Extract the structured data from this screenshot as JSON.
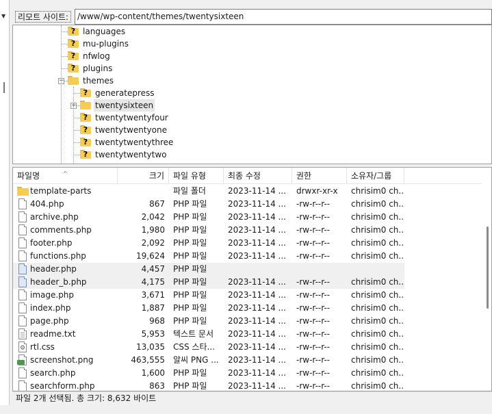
{
  "remote": {
    "label": "리모트 사이트:",
    "path": "/www/wp-content/themes/twentysixteen"
  },
  "tree": {
    "items": [
      {
        "name": "languages",
        "icon": "unknown-folder-icon",
        "level": 1
      },
      {
        "name": "mu-plugins",
        "icon": "unknown-folder-icon",
        "level": 1
      },
      {
        "name": "nfwlog",
        "icon": "unknown-folder-icon",
        "level": 1
      },
      {
        "name": "plugins",
        "icon": "unknown-folder-icon",
        "level": 1
      },
      {
        "name": "themes",
        "icon": "folder-icon",
        "level": 1,
        "expanded": true
      },
      {
        "name": "generatepress",
        "icon": "unknown-folder-icon",
        "level": 2
      },
      {
        "name": "twentysixteen",
        "icon": "folder-icon",
        "level": 2,
        "selected": true,
        "expander": "+"
      },
      {
        "name": "twentytwentyfour",
        "icon": "unknown-folder-icon",
        "level": 2
      },
      {
        "name": "twentytwentyone",
        "icon": "unknown-folder-icon",
        "level": 2
      },
      {
        "name": "twentytwentythree",
        "icon": "unknown-folder-icon",
        "level": 2
      },
      {
        "name": "twentytwentytwo",
        "icon": "unknown-folder-icon",
        "level": 2
      }
    ]
  },
  "list": {
    "columns": {
      "name": "파일명",
      "size": "크기",
      "type": "파일 유형",
      "modified": "최종 수정",
      "perms": "권한",
      "owner": "소유자/그룹"
    },
    "rows": [
      {
        "name": "template-parts",
        "icon": "folder-icon",
        "size": "",
        "type": "파일 폴더",
        "modified": "2023-11-14 ...",
        "perms": "drwxr-xr-x",
        "owner": "chrisim0 ch...",
        "selected": false
      },
      {
        "name": "404.php",
        "icon": "file-icon",
        "size": "867",
        "type": "PHP 파일",
        "modified": "2023-11-14 ...",
        "perms": "-rw-r--r--",
        "owner": "chrisim0 ch...",
        "selected": false
      },
      {
        "name": "archive.php",
        "icon": "file-icon",
        "size": "2,042",
        "type": "PHP 파일",
        "modified": "2023-11-14 ...",
        "perms": "-rw-r--r--",
        "owner": "chrisim0 ch...",
        "selected": false
      },
      {
        "name": "comments.php",
        "icon": "file-icon",
        "size": "1,980",
        "type": "PHP 파일",
        "modified": "2023-11-14 ...",
        "perms": "-rw-r--r--",
        "owner": "chrisim0 ch...",
        "selected": false
      },
      {
        "name": "footer.php",
        "icon": "file-icon",
        "size": "2,092",
        "type": "PHP 파일",
        "modified": "2023-11-14 ...",
        "perms": "-rw-r--r--",
        "owner": "chrisim0 ch...",
        "selected": false
      },
      {
        "name": "functions.php",
        "icon": "file-icon",
        "size": "19,624",
        "type": "PHP 파일",
        "modified": "2023-11-14 ...",
        "perms": "-rw-r--r--",
        "owner": "chrisim0 ch...",
        "selected": false
      },
      {
        "name": "header.php",
        "icon": "file-icon",
        "size": "4,457",
        "type": "PHP 파일",
        "modified": "",
        "perms": "",
        "owner": "",
        "selected": true
      },
      {
        "name": "header_b.php",
        "icon": "file-icon",
        "size": "4,175",
        "type": "PHP 파일",
        "modified": "2023-11-14 ...",
        "perms": "-rw-r--r--",
        "owner": "chrisim0 ch...",
        "selected": true
      },
      {
        "name": "image.php",
        "icon": "file-icon",
        "size": "3,671",
        "type": "PHP 파일",
        "modified": "2023-11-14 ...",
        "perms": "-rw-r--r--",
        "owner": "chrisim0 ch...",
        "selected": false
      },
      {
        "name": "index.php",
        "icon": "file-icon",
        "size": "1,887",
        "type": "PHP 파일",
        "modified": "2023-11-14 ...",
        "perms": "-rw-r--r--",
        "owner": "chrisim0 ch...",
        "selected": false
      },
      {
        "name": "page.php",
        "icon": "file-icon",
        "size": "968",
        "type": "PHP 파일",
        "modified": "2023-11-14 ...",
        "perms": "-rw-r--r--",
        "owner": "chrisim0 ch...",
        "selected": false
      },
      {
        "name": "readme.txt",
        "icon": "text-file-icon",
        "size": "5,953",
        "type": "텍스트 문서",
        "modified": "2023-11-14 ...",
        "perms": "-rw-r--r--",
        "owner": "chrisim0 ch...",
        "selected": false
      },
      {
        "name": "rtl.css",
        "icon": "css-file-icon",
        "size": "13,035",
        "type": "CSS 스타...",
        "modified": "2023-11-14 ...",
        "perms": "-rw-r--r--",
        "owner": "chrisim0 ch...",
        "selected": false
      },
      {
        "name": "screenshot.png",
        "icon": "image-file-icon",
        "size": "463,555",
        "type": "알씨 PNG ...",
        "modified": "2023-11-14 ...",
        "perms": "-rw-r--r--",
        "owner": "chrisim0 ch...",
        "selected": false
      },
      {
        "name": "search.php",
        "icon": "file-icon",
        "size": "1,600",
        "type": "PHP 파일",
        "modified": "2023-11-14 ...",
        "perms": "-rw-r--r--",
        "owner": "chrisim0 ch...",
        "selected": false
      },
      {
        "name": "searchform.php",
        "icon": "file-icon",
        "size": "863",
        "type": "PHP 파일",
        "modified": "2023-11-14 ...",
        "perms": "-rw-r--r--",
        "owner": "chrisim0 ch...",
        "selected": false
      }
    ]
  },
  "status": {
    "text": "파일 2개 선택됨. 총 크기: 8,632 바이트"
  }
}
